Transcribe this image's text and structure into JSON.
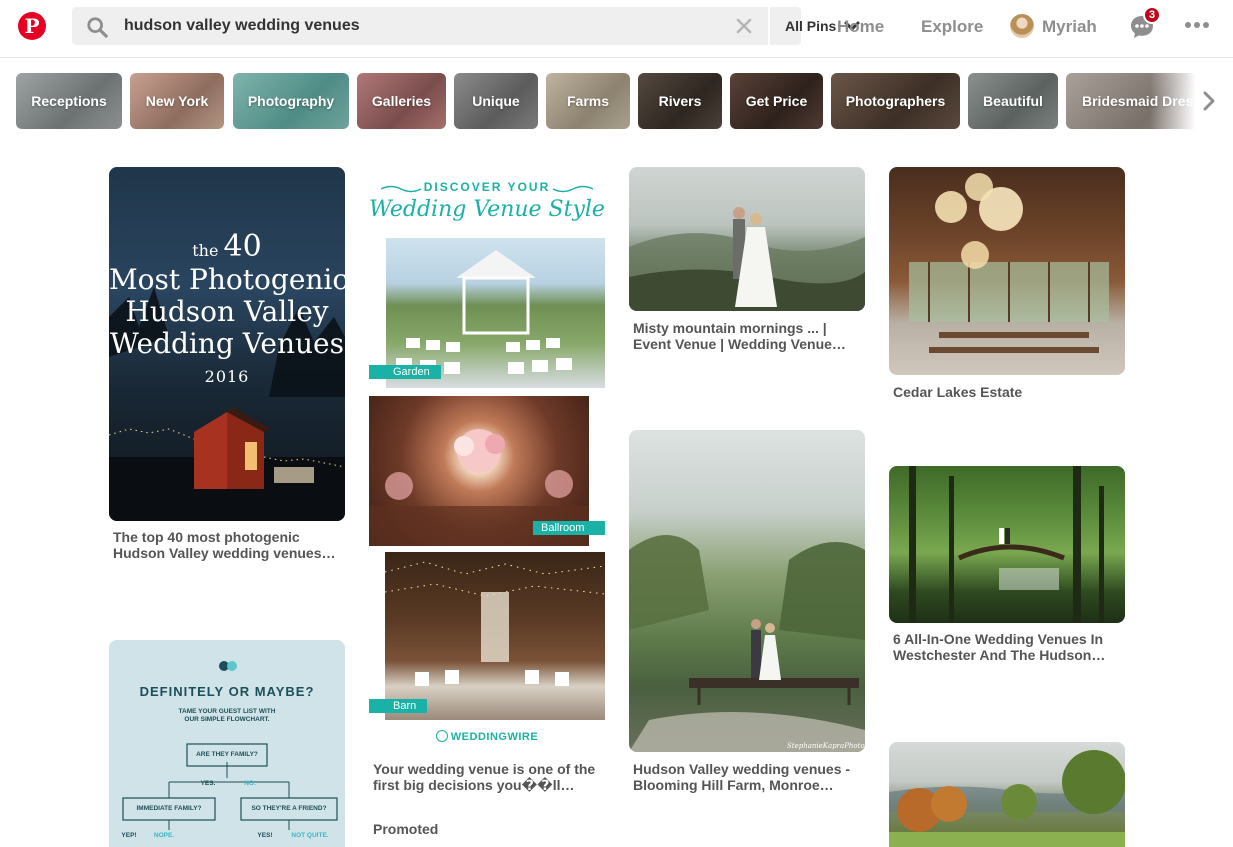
{
  "header": {
    "logo_letter": "P",
    "search": {
      "value": "hudson valley wedding venues",
      "placeholder": "Search"
    },
    "filter_label": "All Pins",
    "nav": {
      "home": "Home",
      "explore": "Explore",
      "user": "Myriah"
    },
    "messages_badge": "3"
  },
  "guides": [
    "Receptions",
    "New York",
    "Photography",
    "Galleries",
    "Unique",
    "Farms",
    "Rivers",
    "Get Price",
    "Photographers",
    "Beautiful",
    "Bridesmaid Dress"
  ],
  "pins": [
    {
      "title": "The top 40 most photogenic Hudson Valley wedding venues…",
      "overlay": {
        "the": "the",
        "num": "40",
        "line1": "Most Photogenic",
        "line2": "Hudson Valley",
        "line3": "Wedding Venues",
        "year": "2016"
      }
    },
    {
      "title": "Your wedding venue is one of the first big decisions you��ll…",
      "promoted": "Promoted",
      "overlay": {
        "heading": "DISCOVER YOUR",
        "script": "Wedding Venue Style",
        "tag1": "Garden",
        "tag2": "Ballroom",
        "tag3": "Barn",
        "brand": "WEDDINGWIRE"
      }
    },
    {
      "title": "Misty mountain mornings ... | Event Venue | Wedding Venue…"
    },
    {
      "title": "Hudson Valley wedding venues - Blooming Hill Farm, Monroe…",
      "watermark": "StephanieKapraPhoto.com"
    },
    {
      "title": "Cedar Lakes Estate"
    },
    {
      "title": "6 All-In-One Wedding Venues In Westchester And The Hudson…"
    },
    {
      "overlay": {
        "heading": "DEFINITELY OR MAYBE?",
        "sub1": "TAME YOUR GUEST LIST WITH",
        "sub2": "OUR SIMPLE FLOWCHART.",
        "q1": "ARE THEY FAMILY?",
        "yes": "YES.",
        "no": "NO.",
        "q2": "IMMEDIATE FAMILY?",
        "q3": "SO THEY'RE A FRIEND?",
        "yep": "YEP!",
        "nope": "NOPE.",
        "yes2": "YES!",
        "notquite": "NOT QUITE."
      }
    }
  ],
  "colors": {
    "brand": "#e60023",
    "badge": "#bd081c",
    "teal": "#1ab1a6",
    "nav_gray": "#8e8e8e"
  }
}
